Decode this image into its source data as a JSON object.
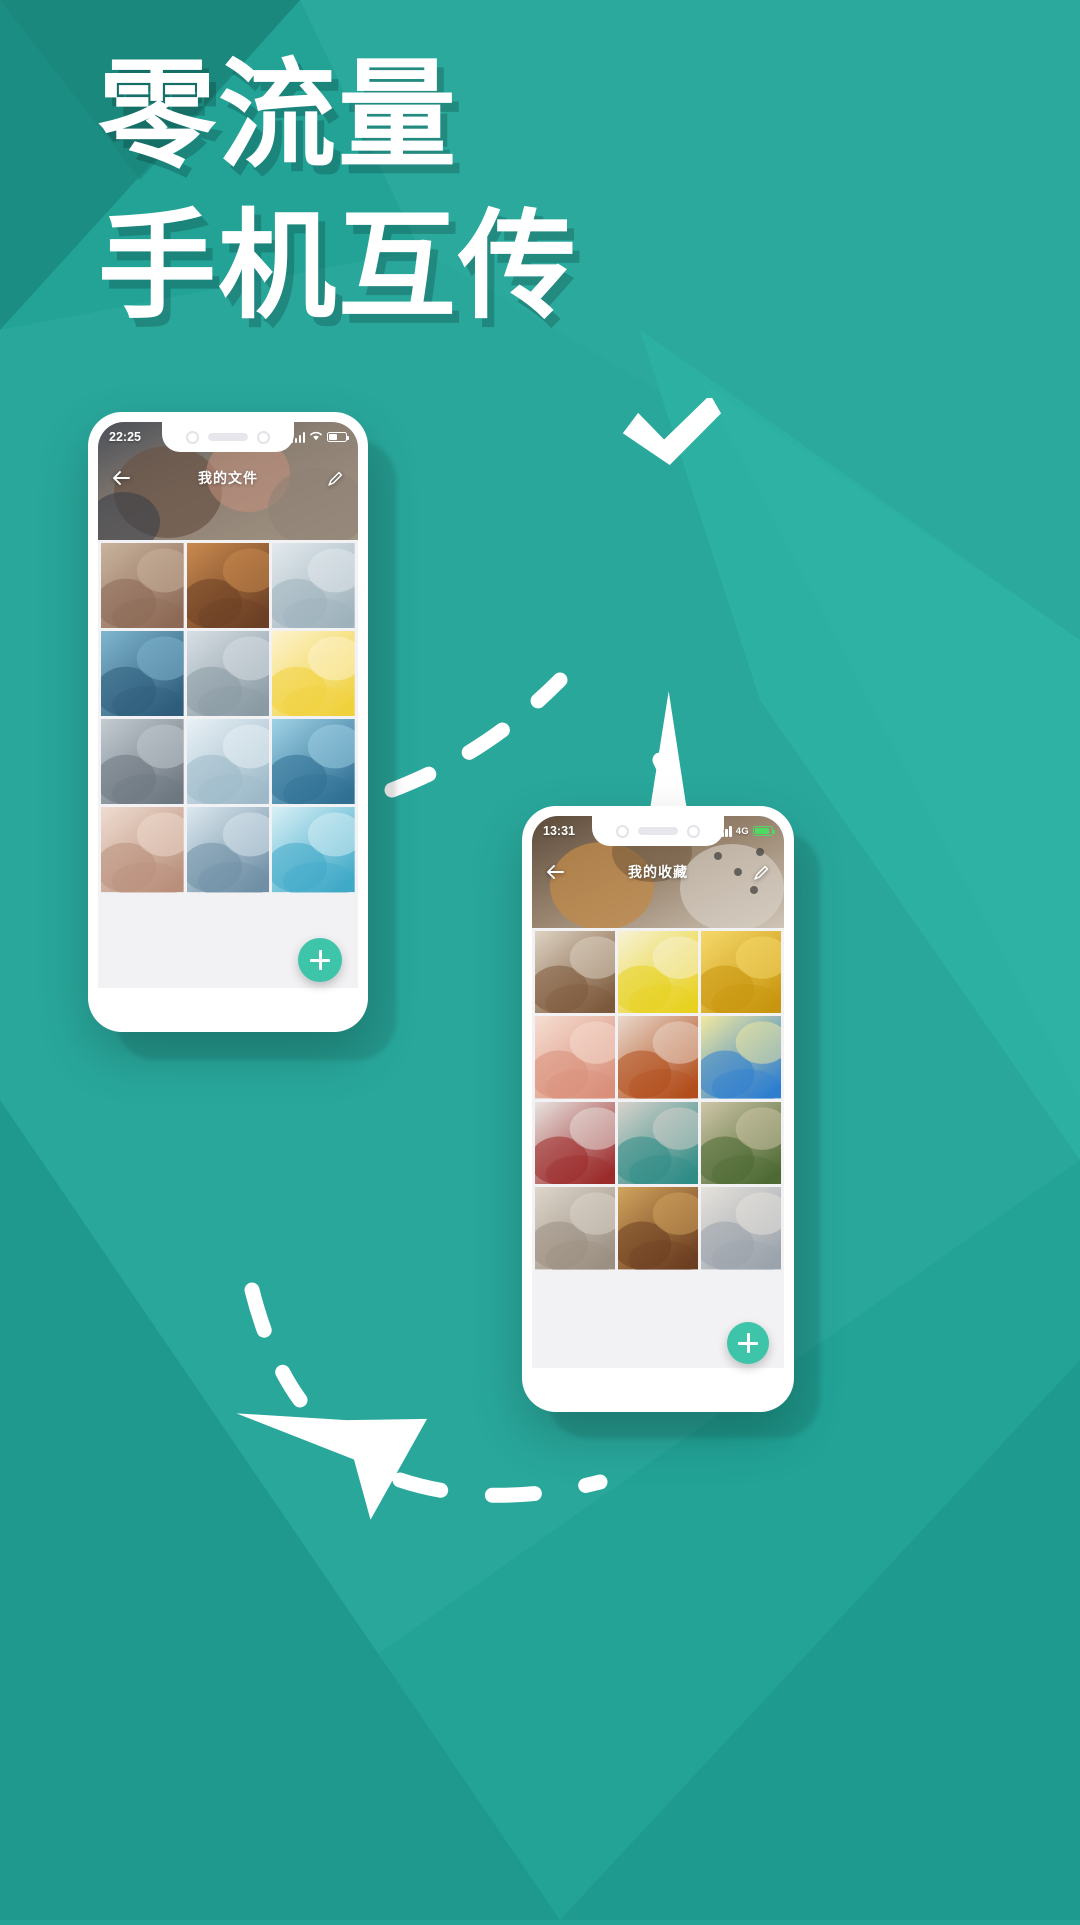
{
  "poster": {
    "background_color": "#22a396",
    "headline_line1": "零流量",
    "headline_line2": "手机互传",
    "headline_color": "#ffffff",
    "accent_color": "#3ec4a8",
    "checkmark_color": "#ffffff",
    "decorations": {
      "checkmark_name": "check-icon",
      "arrow_up_name": "arrow-transfer-up",
      "arrow_down_name": "arrow-transfer-down",
      "dashed_path_name": "dashed-transfer-path"
    }
  },
  "phone1": {
    "status": {
      "time": "22:25",
      "signal_icon": "signal-bars-icon",
      "wifi_icon": "wifi-icon",
      "battery_icon": "battery-icon"
    },
    "appbar": {
      "back_icon": "back-arrow-icon",
      "title": "我的文件",
      "edit_icon": "pencil-edit-icon"
    },
    "fab": {
      "label": "+",
      "name": "add-button",
      "color": "#3ec4a8"
    },
    "grid": [
      {
        "name": "photo-couple-snow",
        "c1": "#8d6a57",
        "c2": "#c9b49e"
      },
      {
        "name": "photo-room-lights",
        "c1": "#6b3f24",
        "c2": "#c98a4e"
      },
      {
        "name": "photo-winter-forest",
        "c1": "#9fb3bd",
        "c2": "#e3eaee"
      },
      {
        "name": "photo-skateboard",
        "c1": "#2e5c7a",
        "c2": "#7fb6cf"
      },
      {
        "name": "photo-snow-walk",
        "c1": "#8a9aa4",
        "c2": "#d7dfe4"
      },
      {
        "name": "photo-yellow-hoodie",
        "c1": "#f0d13c",
        "c2": "#fdf3cf"
      },
      {
        "name": "photo-skater-bridge",
        "c1": "#6e7780",
        "c2": "#c4ccd2"
      },
      {
        "name": "photo-snow-hikers",
        "c1": "#9db9c9",
        "c2": "#e9f1f6"
      },
      {
        "name": "photo-snowshoe-red",
        "c1": "#2f6f93",
        "c2": "#9fd2e6"
      },
      {
        "name": "photo-bed-relax",
        "c1": "#b9907c",
        "c2": "#efdcd0"
      },
      {
        "name": "photo-mountain-snow",
        "c1": "#6f8fa5",
        "c2": "#dce8ef"
      },
      {
        "name": "photo-beach-villa",
        "c1": "#3fa9c8",
        "c2": "#d8f0f6"
      }
    ]
  },
  "phone2": {
    "status": {
      "time": "13:31",
      "signal_icon": "signal-bars-icon",
      "network_label": "4G",
      "battery_icon": "battery-charging-icon"
    },
    "appbar": {
      "back_icon": "back-arrow-icon",
      "title": "我的收藏",
      "edit_icon": "pencil-edit-icon"
    },
    "fab": {
      "label": "+",
      "name": "add-button",
      "color": "#3ec4a8"
    },
    "grid": [
      {
        "name": "photo-breakfast-table",
        "c1": "#7d5a3c",
        "c2": "#ded3c3"
      },
      {
        "name": "photo-please-poster",
        "c1": "#e8d21f",
        "c2": "#f7f2d6"
      },
      {
        "name": "photo-sunflower",
        "c1": "#c8960f",
        "c2": "#f6d96b"
      },
      {
        "name": "photo-pink-clouds",
        "c1": "#d98f7a",
        "c2": "#f6ded2"
      },
      {
        "name": "photo-orange-dress",
        "c1": "#b24e1c",
        "c2": "#e9d8cb"
      },
      {
        "name": "photo-flag-blue-yellow",
        "c1": "#2f7fd0",
        "c2": "#f2e9a0"
      },
      {
        "name": "photo-rose-white",
        "c1": "#9c2a2a",
        "c2": "#e8e4e0"
      },
      {
        "name": "photo-teal-hair",
        "c1": "#2f8c86",
        "c2": "#d8d2cc"
      },
      {
        "name": "photo-herbs-table",
        "c1": "#4d6a33",
        "c2": "#cfc6a8"
      },
      {
        "name": "photo-hands-coat",
        "c1": "#9b8f82",
        "c2": "#ded6cb"
      },
      {
        "name": "photo-desert-road",
        "c1": "#6d3f22",
        "c2": "#d2a45d"
      },
      {
        "name": "photo-arch-doorway",
        "c1": "#9ba3ac",
        "c2": "#e7e3dd"
      }
    ]
  }
}
